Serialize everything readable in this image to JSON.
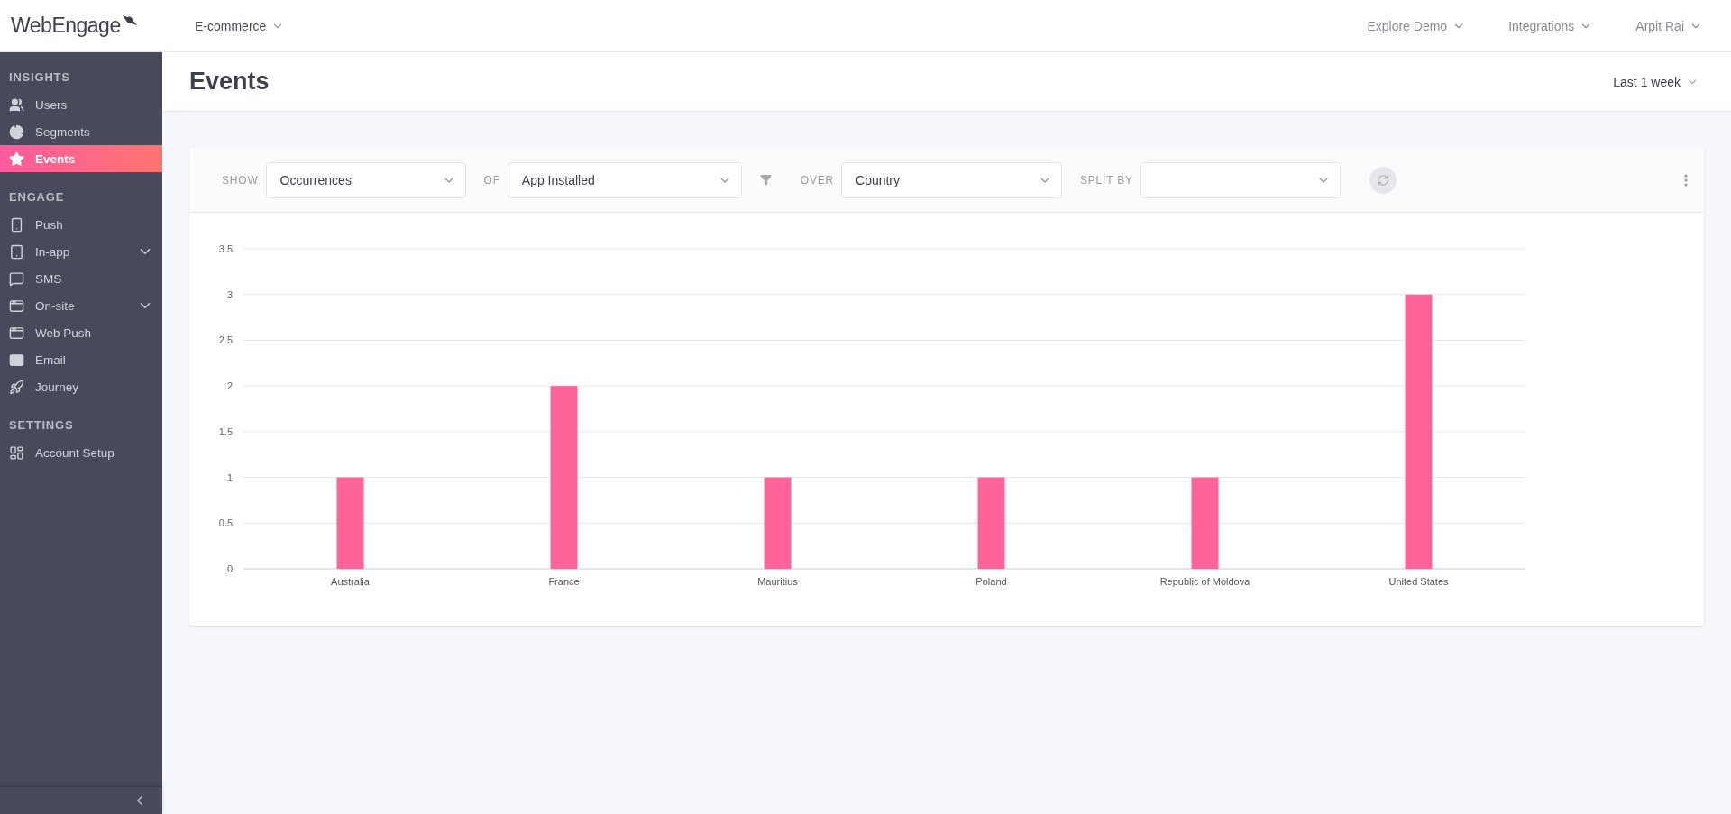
{
  "header": {
    "logo": "WebEngage",
    "project": "E-commerce",
    "menus": [
      "Explore Demo",
      "Integrations",
      "Arpit Rai"
    ]
  },
  "sidebar": {
    "sections": [
      {
        "title": "INSIGHTS",
        "items": [
          {
            "label": "Users",
            "selected": false,
            "has_submenu": false
          },
          {
            "label": "Segments",
            "selected": false,
            "has_submenu": false
          },
          {
            "label": "Events",
            "selected": true,
            "has_submenu": false
          }
        ]
      },
      {
        "title": "ENGAGE",
        "items": [
          {
            "label": "Push",
            "selected": false,
            "has_submenu": false
          },
          {
            "label": "In-app",
            "selected": false,
            "has_submenu": true
          },
          {
            "label": "SMS",
            "selected": false,
            "has_submenu": false
          },
          {
            "label": "On-site",
            "selected": false,
            "has_submenu": true
          },
          {
            "label": "Web Push",
            "selected": false,
            "has_submenu": false
          },
          {
            "label": "Email",
            "selected": false,
            "has_submenu": false
          },
          {
            "label": "Journey",
            "selected": false,
            "has_submenu": false
          }
        ]
      },
      {
        "title": "SETTINGS",
        "items": [
          {
            "label": "Account Setup",
            "selected": false,
            "has_submenu": false
          }
        ]
      }
    ]
  },
  "page": {
    "title": "Events",
    "range": "Last 1 week"
  },
  "toolbar": {
    "show": {
      "label": "SHOW",
      "value": "Occurrences"
    },
    "of": {
      "label": "OF",
      "value": "App Installed"
    },
    "over": {
      "label": "OVER",
      "value": "Country"
    },
    "split_by": {
      "label": "SPLIT BY"
    }
  },
  "chart_data": {
    "type": "bar",
    "categories": [
      "Australia",
      "France",
      "Mauritius",
      "Poland",
      "Republic of Moldova",
      "United States"
    ],
    "values": [
      1,
      2,
      1,
      1,
      1,
      3
    ],
    "ylim": [
      0,
      3.5
    ],
    "yticks": [
      0,
      0.5,
      1,
      1.5,
      2,
      2.5,
      3,
      3.5
    ],
    "grid": true
  }
}
